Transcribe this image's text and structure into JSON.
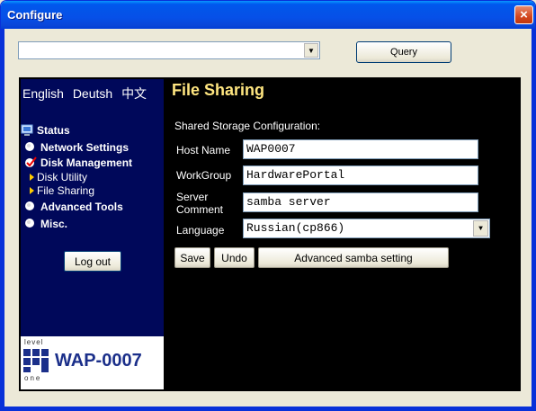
{
  "window": {
    "title": "Configure",
    "close_label": "×"
  },
  "toolbar": {
    "device_value": "",
    "query_label": "Query"
  },
  "languages": [
    "English",
    "Deutsh",
    "中文"
  ],
  "nav": {
    "status": "Status",
    "network_settings": "Network Settings",
    "disk_management": "Disk Management",
    "disk_utility": "Disk Utility",
    "file_sharing": "File Sharing",
    "advanced_tools": "Advanced Tools",
    "misc": "Misc."
  },
  "logout_label": "Log out",
  "logo": {
    "level": "level",
    "one": "one",
    "model": "WAP-0007"
  },
  "page": {
    "title": "File Sharing",
    "section": "Shared Storage Configuration:",
    "fields": {
      "host_name_label": "Host Name",
      "host_name_value": "WAP0007",
      "workgroup_label": "WorkGroup",
      "workgroup_value": "HardwarePortal",
      "server_comment_label_1": "Server",
      "server_comment_label_2": "Comment",
      "server_comment_value": "samba server",
      "language_label": "Language",
      "language_value": "Russian(cp866)"
    },
    "buttons": {
      "save": "Save",
      "undo": "Undo",
      "advanced": "Advanced samba setting"
    }
  },
  "colors": {
    "sidebar_bg": "#00085a",
    "title_color": "#ffe680",
    "titlebar": "#0453e8"
  }
}
